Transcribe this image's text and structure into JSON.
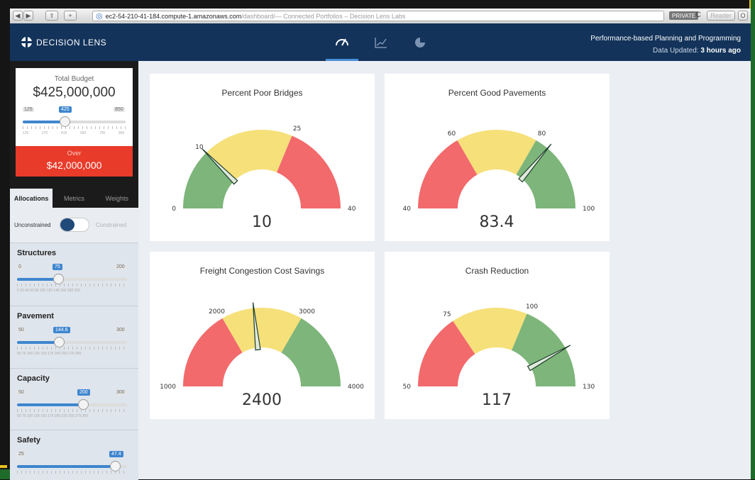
{
  "browser": {
    "nav_back": "◀",
    "nav_fwd": "▶",
    "share": "⇪",
    "add": "+",
    "url_host": "ec2-54-210-41-184.compute-1.amazonaws.com",
    "url_path": "/dashboard/",
    "page_title": " — Connected Portfolios – Decision Lens Labs",
    "private_label": "PRIVATE",
    "reload": "C",
    "reader_label": "Reader",
    "extra_icon": "O"
  },
  "header": {
    "brand": "DECISION LENS",
    "title": "Performance-based Planning and Programming",
    "updated_prefix": "Data Updated: ",
    "updated_value": "3 hours ago",
    "tabs": [
      {
        "name": "gauge",
        "icon": "speedometer-icon",
        "glyph": "◠"
      },
      {
        "name": "chart",
        "icon": "line-chart-icon",
        "glyph": "⟋"
      },
      {
        "name": "pie",
        "icon": "pie-chart-icon",
        "glyph": "◐"
      }
    ]
  },
  "budget": {
    "label": "Total Budget",
    "value": "$425,000,000",
    "min": "125",
    "current": "425",
    "max": "850",
    "ticks": [
      "125",
      "270",
      "415",
      "560",
      "705",
      "850"
    ],
    "fill": 0.41
  },
  "over": {
    "label": "Over",
    "value": "$42,000,000"
  },
  "sidebar_tabs": [
    "Allocations",
    "Metrics",
    "Weights"
  ],
  "toggle": {
    "left_label": "Unconstrained",
    "right_label": "Constrained"
  },
  "allocations": [
    {
      "title": "Structures",
      "min": "0",
      "current": "75",
      "max": "200",
      "fill": 0.375,
      "ticks": "0  20  40  60  80  100  120  140  160  180  200"
    },
    {
      "title": "Pavement",
      "min": "50",
      "current": "144.6",
      "max": "300",
      "fill": 0.38,
      "ticks": "50  75  100  125  150  175  200   250  275  300"
    },
    {
      "title": "Capacity",
      "min": "50",
      "current": "200",
      "max": "300",
      "fill": 0.6,
      "ticks": "50  75  100  125  150  175  200  225  250  275  300"
    },
    {
      "title": "Safety",
      "min": "25",
      "current": "47.4",
      "max": "",
      "fill": 0.89,
      "ticks": ""
    }
  ],
  "gauges": [
    {
      "title": "Percent Poor Bridges",
      "min": "0",
      "max": "40",
      "t1": "10",
      "t2": "25",
      "value": "10",
      "vmin": 0,
      "vmax": 40,
      "v1": 10,
      "v2": 25,
      "v": 10,
      "colors": [
        "#7db57a",
        "#f6e07a",
        "#f26a6c"
      ]
    },
    {
      "title": "Percent Good Pavements",
      "min": "40",
      "max": "100",
      "t1": "60",
      "t2": "80",
      "value": "83.4",
      "vmin": 40,
      "vmax": 100,
      "v1": 60,
      "v2": 80,
      "v": 83.4,
      "colors": [
        "#f26a6c",
        "#f6e07a",
        "#7db57a"
      ]
    },
    {
      "title": "Freight Congestion Cost Savings",
      "min": "1000",
      "max": "4000",
      "t1": "2000",
      "t2": "3000",
      "value": "2400",
      "vmin": 1000,
      "vmax": 4000,
      "v1": 2000,
      "v2": 3000,
      "v": 2400,
      "colors": [
        "#f26a6c",
        "#f6e07a",
        "#7db57a"
      ]
    },
    {
      "title": "Crash Reduction",
      "min": "50",
      "max": "130",
      "t1": "75",
      "t2": "100",
      "value": "117",
      "vmin": 50,
      "vmax": 130,
      "v1": 75,
      "v2": 100,
      "v": 117,
      "colors": [
        "#f26a6c",
        "#f6e07a",
        "#7db57a"
      ]
    }
  ]
}
